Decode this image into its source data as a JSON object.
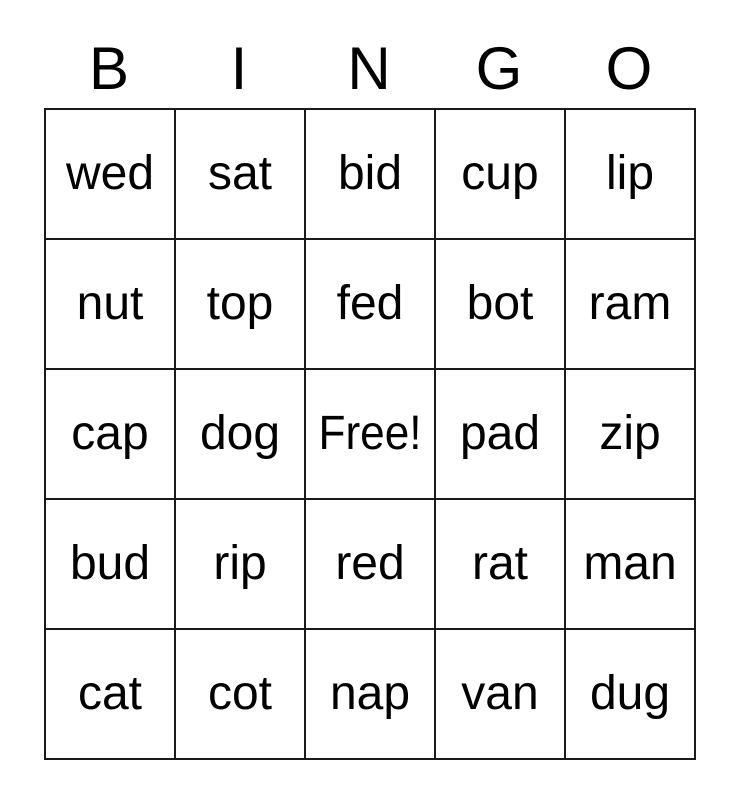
{
  "card": {
    "title": "BINGO",
    "header_letters": [
      "B",
      "I",
      "N",
      "G",
      "O"
    ],
    "free_space_label": "Free!",
    "colors": {
      "background": "#ffffff",
      "border": "#1a1a1a",
      "text": "#000000"
    },
    "grid": {
      "rows": 5,
      "columns": 5,
      "cells": [
        [
          "wed",
          "sat",
          "bid",
          "cup",
          "lip"
        ],
        [
          "nut",
          "top",
          "fed",
          "bot",
          "ram"
        ],
        [
          "cap",
          "dog",
          "Free!",
          "pad",
          "zip"
        ],
        [
          "bud",
          "rip",
          "red",
          "rat",
          "man"
        ],
        [
          "cat",
          "cot",
          "nap",
          "van",
          "dug"
        ]
      ]
    }
  }
}
